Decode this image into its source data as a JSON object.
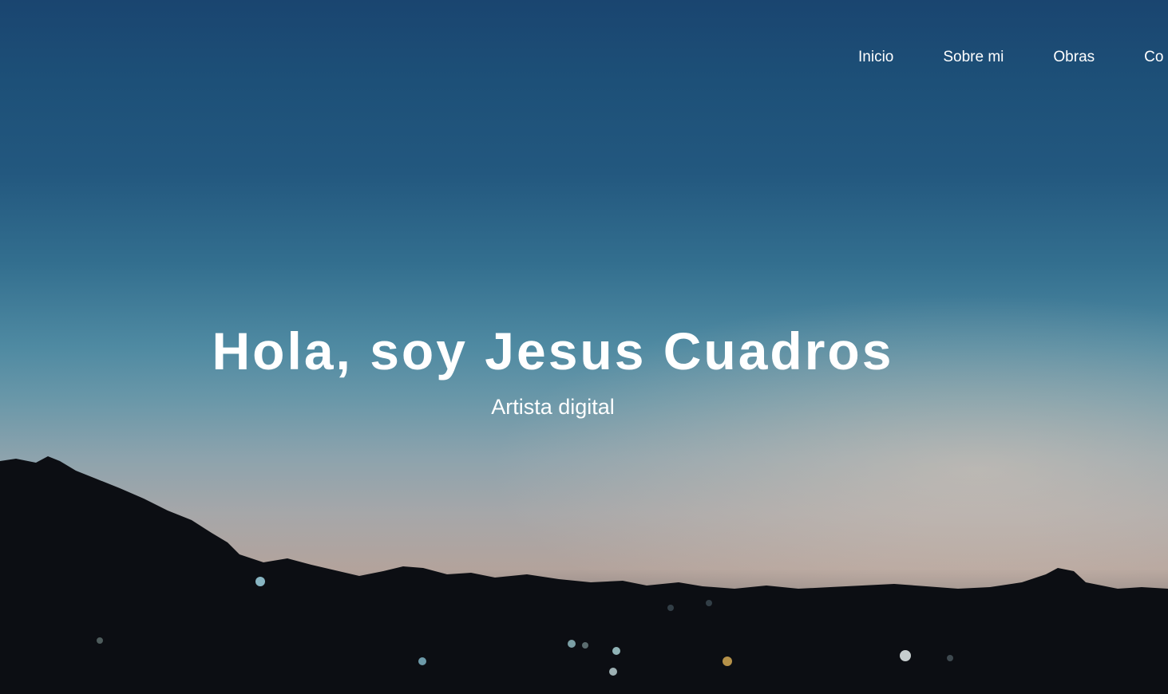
{
  "nav": {
    "items": [
      {
        "label": "Inicio"
      },
      {
        "label": "Sobre mi"
      },
      {
        "label": "Obras"
      },
      {
        "label": "Co"
      }
    ]
  },
  "hero": {
    "title": "Hola, soy Jesus Cuadros",
    "subtitle": "Artista digital"
  },
  "colors": {
    "sky_top": "#1a4570",
    "sky_mid": "#4f8aa2",
    "horizon": "#b3a39c",
    "silhouette": "#0c0e13",
    "text": "#ffffff"
  }
}
